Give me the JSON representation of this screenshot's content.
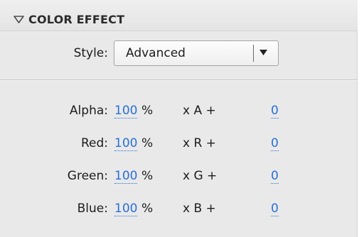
{
  "panel": {
    "title": "COLOR EFFECT",
    "collapse_icon": "triangle-down-icon"
  },
  "style": {
    "label": "Style:",
    "value": "Advanced",
    "dropdown_icon": "triangle-down-icon"
  },
  "rows": [
    {
      "label": "Alpha:",
      "percent": "100",
      "percent_unit": "%",
      "multiplier": "x A +",
      "offset": "0"
    },
    {
      "label": "Red:",
      "percent": "100",
      "percent_unit": "%",
      "multiplier": "x R +",
      "offset": "0"
    },
    {
      "label": "Green:",
      "percent": "100",
      "percent_unit": "%",
      "multiplier": "x G +",
      "offset": "0"
    },
    {
      "label": "Blue:",
      "percent": "100",
      "percent_unit": "%",
      "multiplier": "x B +",
      "offset": "0"
    }
  ],
  "colors": {
    "panel_bg": "#e9e9e9",
    "link_value": "#2a6fd6",
    "text": "#1c1c1c"
  }
}
